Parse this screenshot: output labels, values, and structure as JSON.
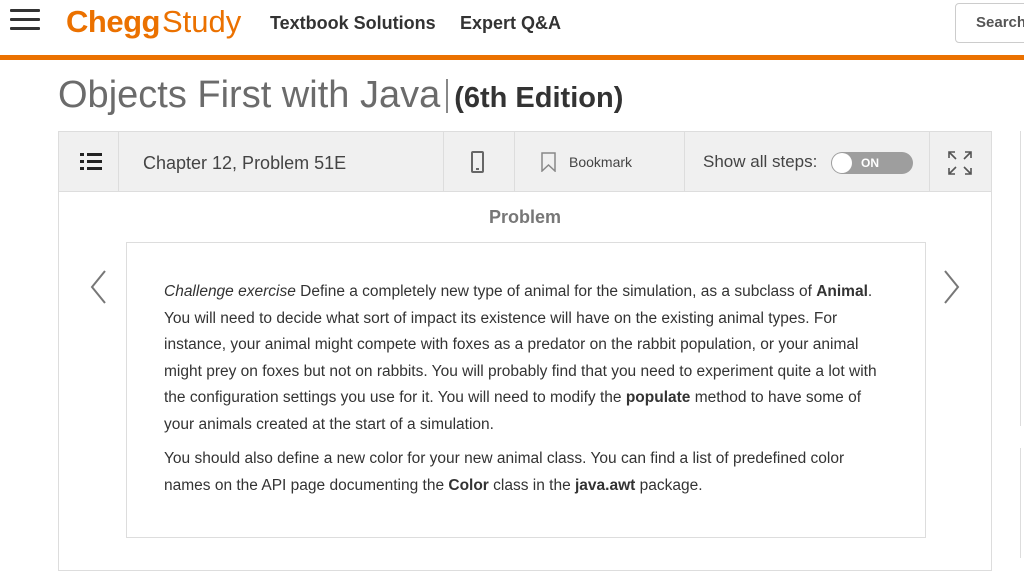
{
  "header": {
    "logo_primary": "Chegg",
    "logo_secondary": "Study",
    "nav": [
      "Textbook Solutions",
      "Expert Q&A"
    ],
    "search_label": "Search"
  },
  "book": {
    "title": "Objects First with Java",
    "edition": "(6th Edition)"
  },
  "toolbar": {
    "chapter_problem": "Chapter 12, Problem 51E",
    "bookmark_label": "Bookmark",
    "show_steps_label": "Show all steps:",
    "toggle_label": "ON"
  },
  "problem": {
    "heading": "Problem",
    "p1": {
      "lead": "Challenge exercise",
      "t1": " Define a completely new type of animal for the simulation, as a subclass of ",
      "b1": "Animal",
      "t2": ". You will need to decide what sort of impact its existence will have on the existing animal types. For instance, your animal might compete with foxes as a predator on the rabbit population, or your animal might prey on foxes but not on rabbits. You will probably find that you need to experiment quite a lot with the configuration settings you use for it. You will need to modify the ",
      "b2": "populate",
      "t3": " method to have some of your animals created at the start of a simulation."
    },
    "p2": {
      "t1": "You should also define a new color for your new animal class. You can find a list of predefined color names on the API page documenting the ",
      "b1": "Color",
      "t2": " class in the ",
      "b2": "java.awt",
      "t3": " package."
    }
  },
  "colors": {
    "brand_orange": "#eb7100",
    "toolbar_bg": "#f0f0f0",
    "toggle_bg": "#9e9e9e"
  },
  "icons": [
    "menu-icon",
    "list-icon",
    "phone-icon",
    "bookmark-icon",
    "expand-icon",
    "chevron-left-icon",
    "chevron-right-icon"
  ]
}
